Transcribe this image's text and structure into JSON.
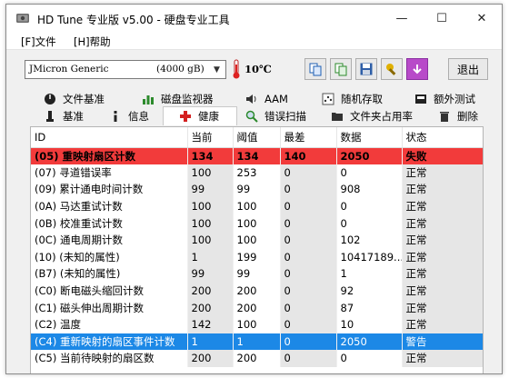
{
  "window": {
    "title": "HD Tune 专业版 v5.00 - 硬盘专业工具",
    "controls": {
      "minimize": "—",
      "maximize": "☐",
      "close": "✕"
    }
  },
  "menu": {
    "file": "[F]文件",
    "help": "[H]帮助"
  },
  "toolbar": {
    "drive_name": "JMicron Generic",
    "drive_capacity": "(4000 gB)",
    "temperature": "10℃",
    "exit_label": "退出"
  },
  "tabs": {
    "row1": [
      "文件基准",
      "磁盘监视器",
      "AAM",
      "随机存取",
      "额外测试"
    ],
    "row2": [
      "基准",
      "信息",
      "健康",
      "错误扫描",
      "文件夹占用率",
      "删除"
    ],
    "active": "健康"
  },
  "table": {
    "headers": [
      "ID",
      "当前",
      "阈值",
      "最差",
      "数据",
      "状态"
    ],
    "rows": [
      [
        "(05) 重映射扇区计数",
        "134",
        "134",
        "140",
        "2050",
        "失败"
      ],
      [
        "(07) 寻道错误率",
        "100",
        "253",
        "0",
        "0",
        "正常"
      ],
      [
        "(09) 累计通电时间计数",
        "99",
        "99",
        "0",
        "908",
        "正常"
      ],
      [
        "(0A) 马达重试计数",
        "100",
        "100",
        "0",
        "0",
        "正常"
      ],
      [
        "(0B) 校准重试计数",
        "100",
        "100",
        "0",
        "0",
        "正常"
      ],
      [
        "(0C) 通电周期计数",
        "100",
        "100",
        "0",
        "102",
        "正常"
      ],
      [
        "(10) (未知的属性)",
        "1",
        "199",
        "0",
        "10417189...",
        "正常"
      ],
      [
        "(B7) (未知的属性)",
        "99",
        "99",
        "0",
        "1",
        "正常"
      ],
      [
        "(C0) 断电磁头缩回计数",
        "200",
        "200",
        "0",
        "92",
        "正常"
      ],
      [
        "(C1) 磁头伸出周期计数",
        "200",
        "200",
        "0",
        "87",
        "正常"
      ],
      [
        "(C2) 温度",
        "142",
        "100",
        "0",
        "10",
        "正常"
      ],
      [
        "(C4) 重新映射的扇区事件计数",
        "1",
        "1",
        "0",
        "2050",
        "警告"
      ],
      [
        "(C5) 当前待映射的扇区数",
        "200",
        "200",
        "0",
        "0",
        "正常"
      ]
    ],
    "failed_row": 0,
    "selected_row": 11
  },
  "colors": {
    "fail": "#f23b3b",
    "selected": "#1c88e6",
    "alt_column": "#e6e6e6"
  }
}
